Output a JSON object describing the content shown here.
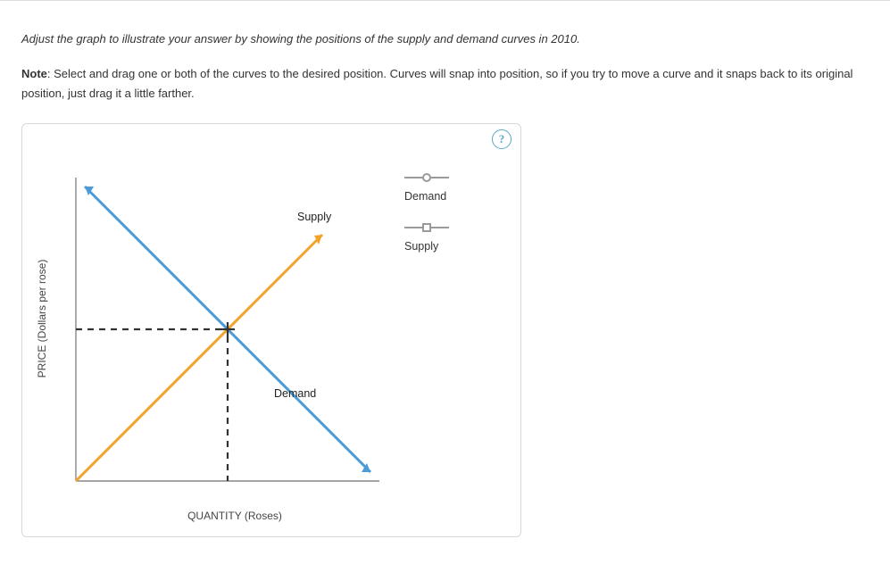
{
  "instruction": "Adjust the graph to illustrate your answer by showing the positions of the supply and demand curves in 2010.",
  "note_label": "Note",
  "note_text": ": Select and drag one or both of the curves to the desired position. Curves will snap into position, so if you try to move a curve and it snaps back to its original position, just drag it a little farther.",
  "help_glyph": "?",
  "yaxis_label": "PRICE (Dollars per rose)",
  "xaxis_label": "QUANTITY (Roses)",
  "curve_labels": {
    "supply": "Supply",
    "demand": "Demand"
  },
  "legend": {
    "demand": "Demand",
    "supply": "Supply"
  },
  "chart_data": {
    "type": "line",
    "title": "",
    "xlabel": "QUANTITY (Roses)",
    "ylabel": "PRICE (Dollars per rose)",
    "series": [
      {
        "name": "Demand",
        "x": [
          0,
          10
        ],
        "y": [
          10,
          0
        ],
        "color": "#4b9bd8",
        "draggable": true
      },
      {
        "name": "Supply",
        "x": [
          0,
          10
        ],
        "y": [
          0,
          10
        ],
        "color": "#f2a32a",
        "draggable": true
      }
    ],
    "equilibrium": {
      "x": 5,
      "y": 5
    },
    "xlim": [
      0,
      10
    ],
    "ylim": [
      0,
      10
    ],
    "grid": false,
    "legend_position": "right"
  }
}
